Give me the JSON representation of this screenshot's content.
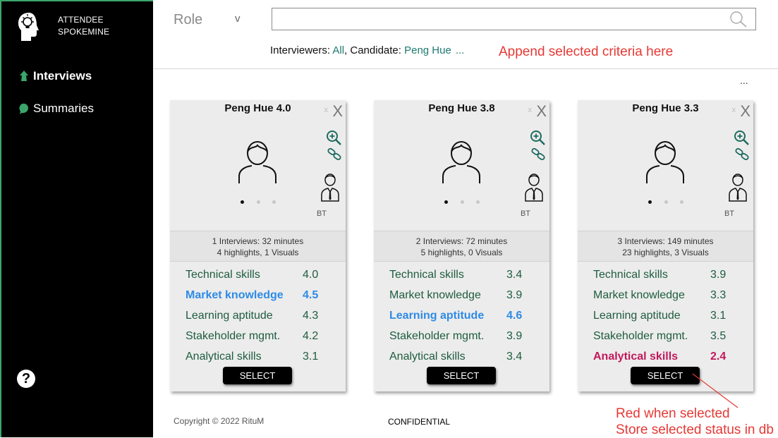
{
  "brand": {
    "line1": "ATTENDEE",
    "line2": "SPOKEMINE"
  },
  "nav": {
    "interviews": "Interviews",
    "summaries": "Summaries"
  },
  "help": {
    "label": "?"
  },
  "topbar": {
    "role_label": "Role",
    "role_chevron": "v",
    "search_value": "",
    "criteria_prefix": "Interviewers: ",
    "interviewers_value": "All",
    "criteria_sep": ", Candidate: ",
    "candidate_value": "Peng Hue",
    "criteria_more": "...",
    "append_note": "Append selected criteria here"
  },
  "more_menu": "...",
  "cards": [
    {
      "title": "Peng Hue 4.0",
      "close_small": "x",
      "close": "X",
      "bt_label": "BT",
      "summary_line1": "1 Interviews: 32 minutes",
      "summary_line2": "4 highlights, 1 Visuals",
      "skills": [
        {
          "name": "Technical skills",
          "value": "4.0"
        },
        {
          "name": "Market knowledge",
          "value": "4.5"
        },
        {
          "name": "Learning aptitude",
          "value": "4.3"
        },
        {
          "name": "Stakeholder mgmt.",
          "value": "4.2"
        },
        {
          "name": "Analytical skills",
          "value": "3.1"
        }
      ],
      "select_label": "SELECT"
    },
    {
      "title": "Peng Hue 3.8",
      "close_small": "x",
      "close": "X",
      "bt_label": "BT",
      "summary_line1": "2 Interviews: 72 minutes",
      "summary_line2": "5 highlights, 0 Visuals",
      "skills": [
        {
          "name": "Technical skills",
          "value": "3.4"
        },
        {
          "name": "Market knowledge",
          "value": "3.9"
        },
        {
          "name": "Learning aptitude",
          "value": "4.6"
        },
        {
          "name": "Stakeholder mgmt.",
          "value": "3.9"
        },
        {
          "name": "Analytical skills",
          "value": "3.4"
        }
      ],
      "select_label": "SELECT"
    },
    {
      "title": "Peng Hue 3.3",
      "close_small": "x",
      "close": "X",
      "bt_label": "BT",
      "summary_line1": "3 Interviews: 149 minutes",
      "summary_line2": "23 highlights, 3 Visuals",
      "skills": [
        {
          "name": "Technical skills",
          "value": "3.9"
        },
        {
          "name": "Market knowledge",
          "value": "3.3"
        },
        {
          "name": "Learning aptitude",
          "value": "3.1"
        },
        {
          "name": "Stakeholder mgmt.",
          "value": "3.5"
        },
        {
          "name": "Analytical skills",
          "value": "2.4"
        }
      ],
      "select_label": "SELECT"
    }
  ],
  "footer": {
    "copyright": "Copyright © 2022 RituM",
    "confidential": "CONFIDENTIAL"
  },
  "annotation": {
    "line1": "Red when selected",
    "line2": "Store selected status in db"
  },
  "colors": {
    "accent_green": "#3aa66a",
    "skill_text": "#1e5c3f",
    "highlight_blue": "#2e8be6",
    "highlight_red": "#c2185b",
    "note_red": "#e53935",
    "link_teal": "#1e7a70"
  }
}
